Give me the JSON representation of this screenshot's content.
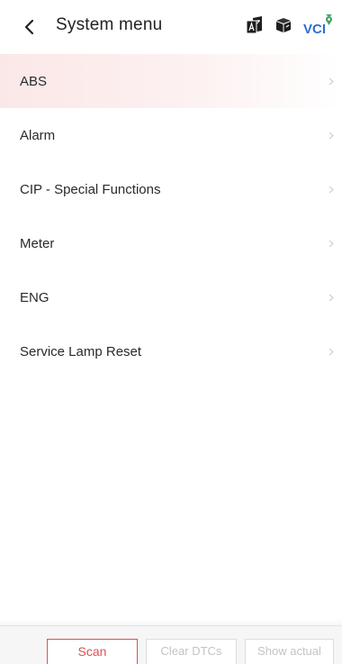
{
  "header": {
    "back_icon": "chevron-left-icon",
    "title": "System menu",
    "icons": {
      "language": "translate-icon",
      "box": "cube-icon",
      "vci": "VCI"
    }
  },
  "menu": {
    "items": [
      {
        "label": "ABS",
        "active": true
      },
      {
        "label": "Alarm",
        "active": false
      },
      {
        "label": "CIP - Special Functions",
        "active": false
      },
      {
        "label": "Meter",
        "active": false
      },
      {
        "label": "ENG",
        "active": false
      },
      {
        "label": "Service Lamp Reset",
        "active": false
      }
    ],
    "chevron_icon": "chevron-right-icon"
  },
  "bottom_bar": {
    "scan_label": "Scan",
    "clear_label": "Clear DTCs",
    "show_label": "Show actual"
  },
  "colors": {
    "accent": "#d9534f",
    "active_row": "#fbe7e7",
    "disabled_text": "#c4c4c4",
    "vci_blue": "#2c6fd6",
    "vci_green": "#3aa35a"
  }
}
